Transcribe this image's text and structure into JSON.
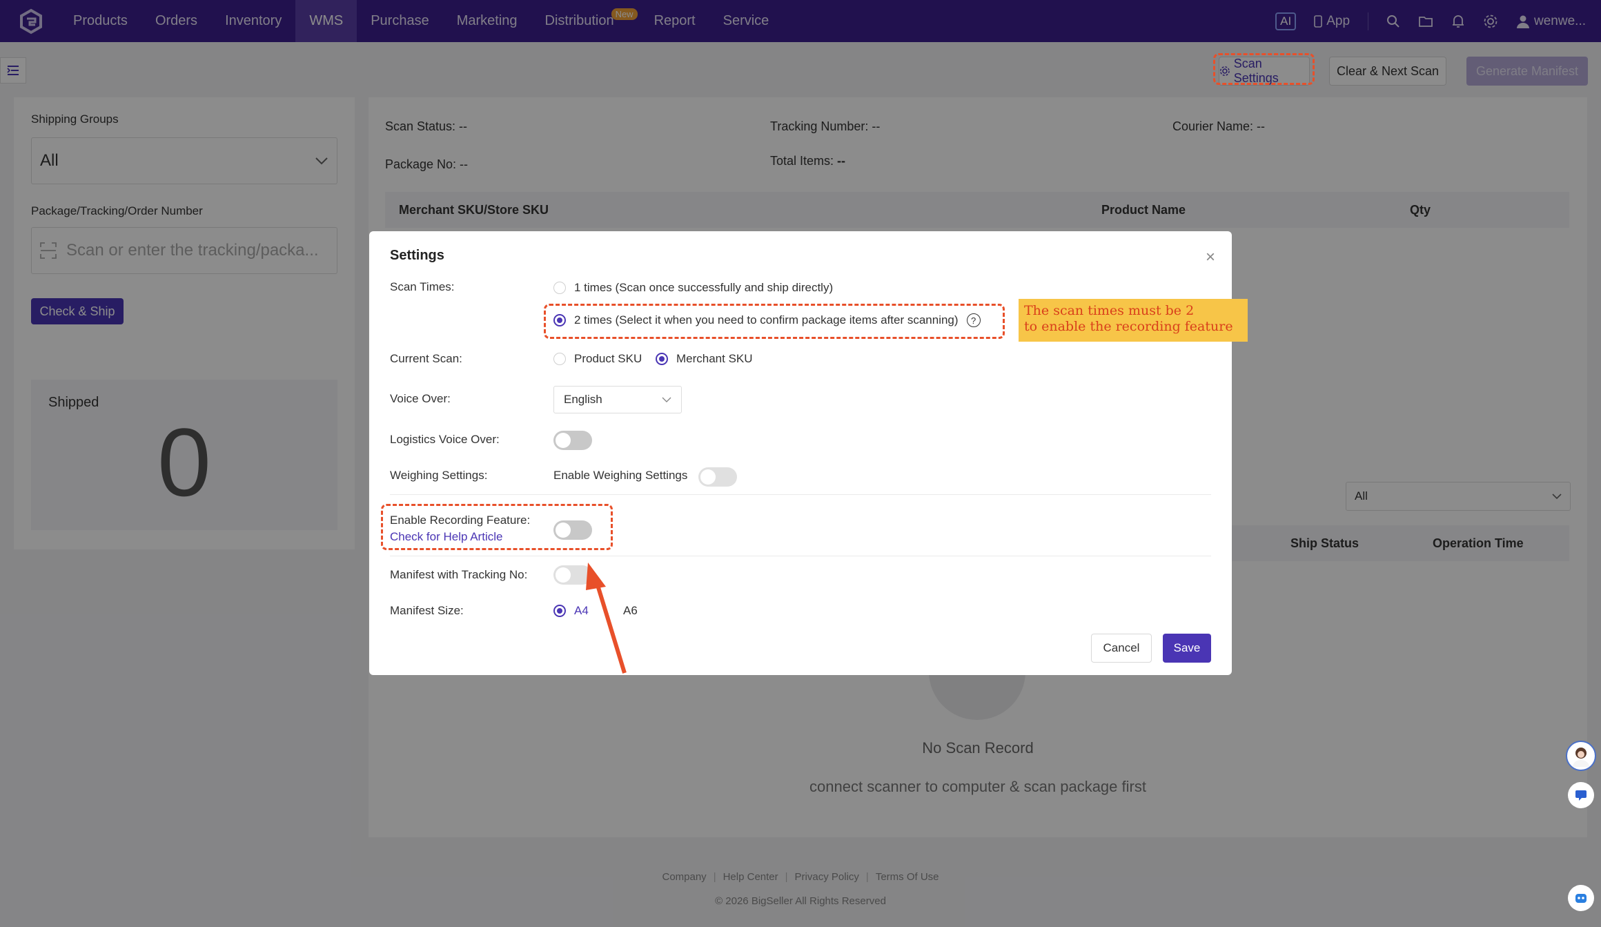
{
  "nav": {
    "items": [
      "Products",
      "Orders",
      "Inventory",
      "WMS",
      "Purchase",
      "Marketing",
      "Distribution",
      "Report",
      "Service"
    ],
    "active": "WMS",
    "distribution_badge": "New",
    "ai_label": "AI",
    "app_label": "App",
    "user": "wenwe..."
  },
  "toolbar": {
    "scan_settings": "Scan Settings",
    "clear_next": "Clear & Next Scan",
    "generate_manifest": "Generate Manifest"
  },
  "left": {
    "shipping_groups_label": "Shipping Groups",
    "shipping_groups_value": "All",
    "package_label": "Package/Tracking/Order Number",
    "package_placeholder": "Scan or enter the tracking/packa...",
    "check_ship": "Check & Ship",
    "shipped_label": "Shipped",
    "shipped_value": "0"
  },
  "main": {
    "scan_status": "Scan Status: --",
    "tracking_number": "Tracking Number: --",
    "courier_name": "Courier Name: --",
    "package_no": "Package No: --",
    "total_items": "Total Items: ",
    "total_items_value": "--",
    "col_sku": "Merchant SKU/Store SKU",
    "col_product": "Product Name",
    "col_qty": "Qty",
    "filter_value": "All",
    "col_ship_status": "Ship Status",
    "col_op_time": "Operation Time",
    "empty_title": "No Scan Record",
    "empty_sub": "connect scanner to computer & scan package first"
  },
  "footer": {
    "links": [
      "Company",
      "Help Center",
      "Privacy Policy",
      "Terms Of Use"
    ],
    "copyright": "© 2026 BigSeller All Rights Reserved"
  },
  "dialog": {
    "title": "Settings",
    "scan_times_label": "Scan Times:",
    "scan_opt1": "1 times (Scan once successfully and ship directly)",
    "scan_opt2": "2 times (Select it when you need to confirm package items after scanning)",
    "current_scan_label": "Current Scan:",
    "current_opt1": "Product SKU",
    "current_opt2": "Merchant SKU",
    "voice_over_label": "Voice Over:",
    "voice_over_value": "English",
    "logistics_voice_label": "Logistics Voice Over:",
    "weighing_label": "Weighing Settings:",
    "weighing_toggle_label": "Enable Weighing Settings",
    "recording_label": "Enable Recording Feature:",
    "help_link": "Check for Help Article",
    "manifest_tracking_label": "Manifest with Tracking No:",
    "manifest_size_label": "Manifest Size:",
    "size_a4": "A4",
    "size_a6": "A6",
    "cancel": "Cancel",
    "save": "Save"
  },
  "annotation": {
    "callout_line1": "The scan times must be 2",
    "callout_line2": "to enable the recording feature",
    "accent_color": "#e8502a"
  }
}
